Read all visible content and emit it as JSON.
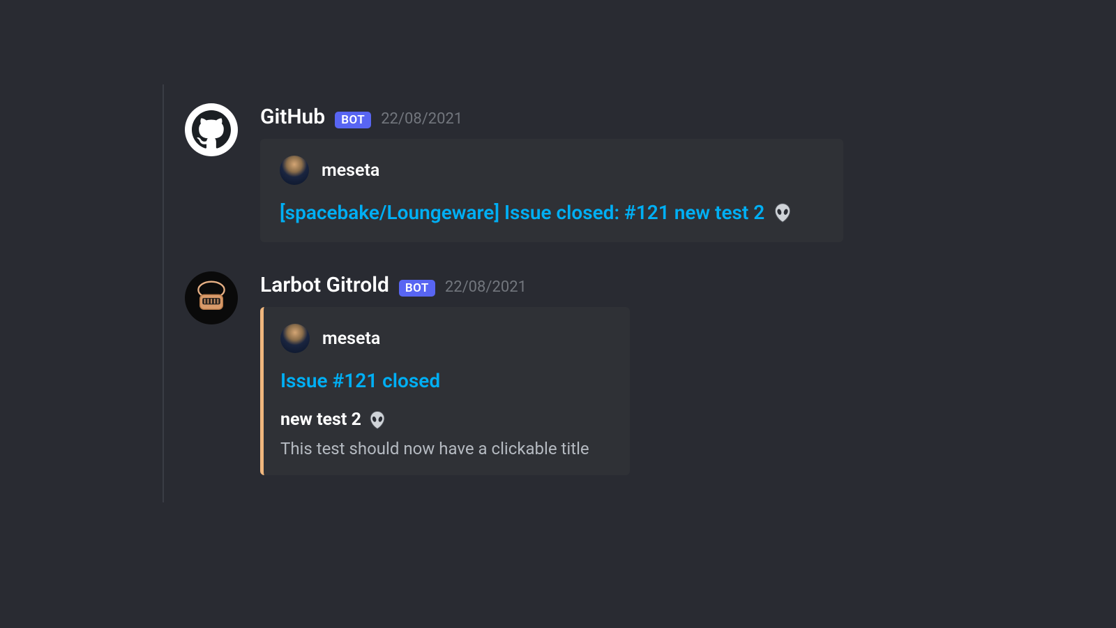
{
  "messages": [
    {
      "username": "GitHub",
      "bot_label": "BOT",
      "timestamp": "22/08/2021",
      "avatar_type": "github",
      "embed": {
        "accent_bar": false,
        "author_name": "meseta",
        "title": "[spacebake/Loungeware] Issue closed: #121 new test 2",
        "title_icon": "alien"
      }
    },
    {
      "username": "Larbot Gitrold",
      "bot_label": "BOT",
      "timestamp": "22/08/2021",
      "avatar_type": "larbot",
      "embed": {
        "accent_bar": true,
        "accent_color": "#f0b77e",
        "author_name": "meseta",
        "title": "Issue #121 closed",
        "subtitle": "new test 2",
        "subtitle_icon": "alien",
        "description": "This test should now have a clickable title"
      }
    }
  ],
  "colors": {
    "background": "#292b32",
    "embed_bg": "#2f3136",
    "link": "#00aff4",
    "bot_badge": "#5865f2",
    "text_muted": "#72767d"
  }
}
